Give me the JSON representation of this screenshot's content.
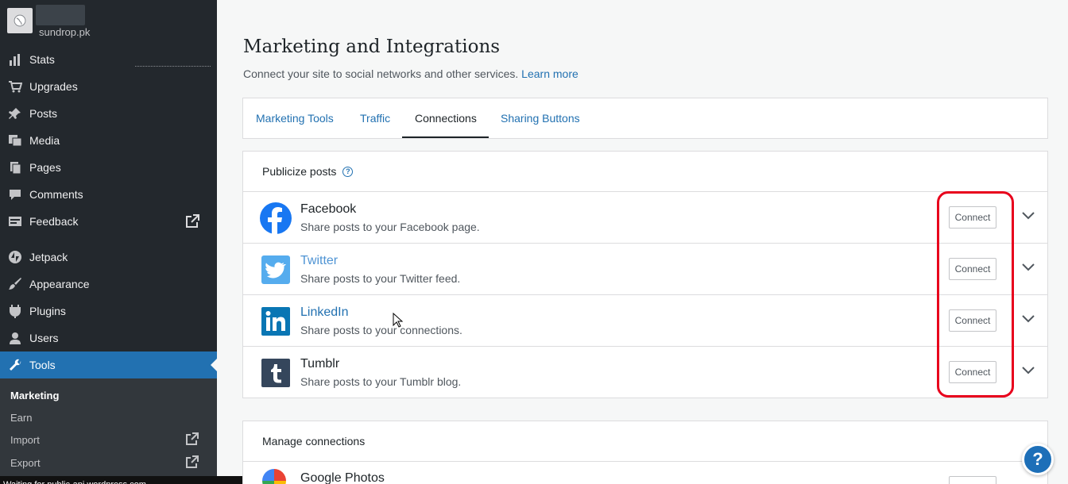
{
  "site": {
    "url": "sundrop.pk"
  },
  "sidebar": {
    "items": [
      {
        "label": "Stats",
        "icon": "stats-icon"
      },
      {
        "label": "Upgrades",
        "icon": "cart-icon"
      },
      {
        "label": "Posts",
        "icon": "pin-icon"
      },
      {
        "label": "Media",
        "icon": "media-icon"
      },
      {
        "label": "Pages",
        "icon": "pages-icon"
      },
      {
        "label": "Comments",
        "icon": "comment-icon"
      },
      {
        "label": "Feedback",
        "icon": "feedback-icon"
      },
      {
        "label": "Jetpack",
        "icon": "jetpack-icon"
      },
      {
        "label": "Appearance",
        "icon": "brush-icon"
      },
      {
        "label": "Plugins",
        "icon": "plugin-icon"
      },
      {
        "label": "Users",
        "icon": "user-icon"
      },
      {
        "label": "Tools",
        "icon": "wrench-icon"
      }
    ],
    "submenu": [
      "Marketing",
      "Earn",
      "Import",
      "Export"
    ]
  },
  "page": {
    "title": "Marketing and Integrations",
    "subtitle": "Connect your site to social networks and other services.",
    "learn_more": "Learn more"
  },
  "tabs": [
    "Marketing Tools",
    "Traffic",
    "Connections",
    "Sharing Buttons"
  ],
  "publicize": {
    "heading": "Publicize posts",
    "services": [
      {
        "name": "Facebook",
        "desc": "Share posts to your Facebook page.",
        "button": "Connect",
        "color": "#1877f2"
      },
      {
        "name": "Twitter",
        "desc": "Share posts to your Twitter feed.",
        "button": "Connect",
        "color": "#55acee"
      },
      {
        "name": "LinkedIn",
        "desc": "Share posts to your connections.",
        "button": "Connect",
        "color": "#0976b4"
      },
      {
        "name": "Tumblr",
        "desc": "Share posts to your Tumblr blog.",
        "button": "Connect",
        "color": "#35465c"
      }
    ]
  },
  "manage": {
    "heading": "Manage connections",
    "first_service": "Google Photos"
  },
  "status_bar": "Waiting for public-api.wordpress.com...",
  "colors": {
    "accent": "#2271b1",
    "sidebar": "#23282d",
    "highlight": "#e8001c"
  }
}
